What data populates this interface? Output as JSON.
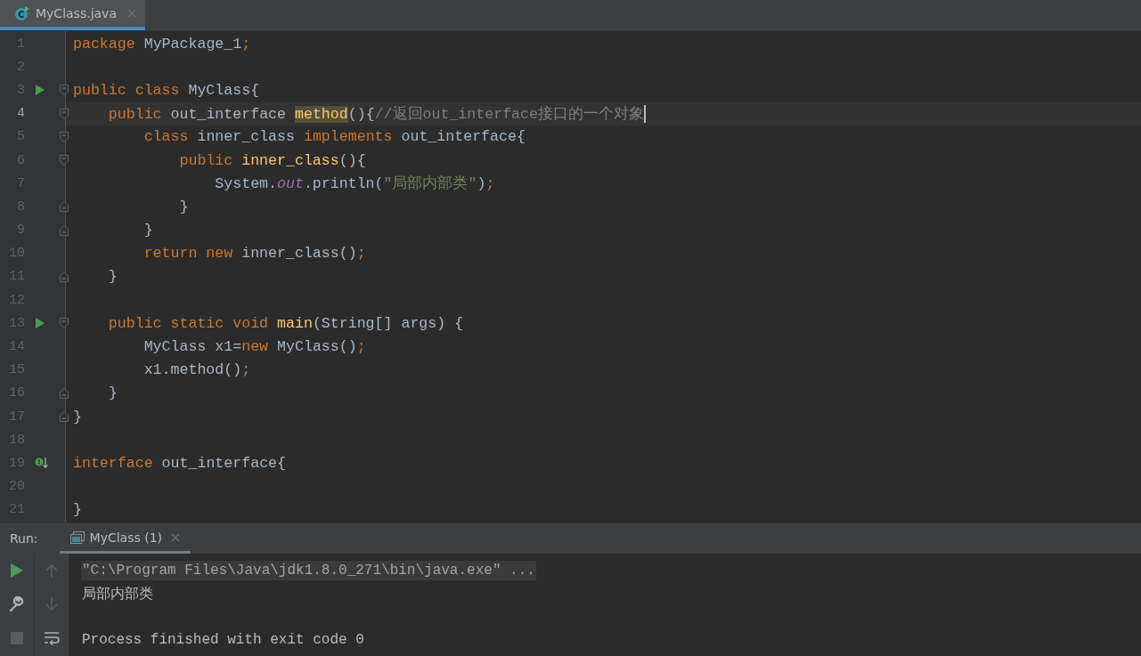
{
  "editor_tabs": [
    {
      "label": "MyClass.java",
      "selected": true
    }
  ],
  "code_lines": [
    {
      "number": "1",
      "kind": "plain",
      "fold_start": false,
      "fold_end": false,
      "current": false,
      "tokens": [
        {
          "kind": "keyword",
          "text": "package "
        },
        {
          "kind": "ident",
          "text": "MyPackage_1"
        },
        {
          "kind": "keyword",
          "text": ";"
        }
      ]
    },
    {
      "number": "2",
      "kind": "plain",
      "fold_start": false,
      "fold_end": false,
      "current": false
    },
    {
      "number": "3",
      "kind": "run",
      "fold_start": true,
      "fold_end": false,
      "current": false,
      "tokens": [
        {
          "kind": "keyword",
          "text": "public class "
        },
        {
          "kind": "ident",
          "text": "MyClass{"
        }
      ]
    },
    {
      "number": "4",
      "kind": "plain",
      "fold_start": true,
      "fold_end": false,
      "current": true,
      "tokens": [
        {
          "kind": "keyword",
          "text": "    public "
        },
        {
          "kind": "ident",
          "text": "out_interface "
        },
        {
          "kind": "method_usage",
          "text": "method"
        },
        {
          "kind": "ident",
          "text": "(){"
        },
        {
          "kind": "comment",
          "text": "//返回out_interface接口的一个对象"
        }
      ]
    },
    {
      "number": "5",
      "kind": "plain",
      "fold_start": true,
      "fold_end": false,
      "current": false,
      "tokens": [
        {
          "kind": "keyword",
          "text": "        class "
        },
        {
          "kind": "ident",
          "text": "inner_class "
        },
        {
          "kind": "keyword",
          "text": "implements "
        },
        {
          "kind": "ident",
          "text": "out_interface{"
        }
      ]
    },
    {
      "number": "6",
      "kind": "plain",
      "fold_start": true,
      "fold_end": false,
      "current": false,
      "tokens": [
        {
          "kind": "keyword",
          "text": "            public "
        },
        {
          "kind": "method",
          "text": "inner_class"
        },
        {
          "kind": "ident",
          "text": "(){"
        }
      ]
    },
    {
      "number": "7",
      "kind": "plain",
      "fold_start": false,
      "fold_end": false,
      "current": false,
      "tokens": [
        {
          "kind": "ident",
          "text": "                System."
        },
        {
          "kind": "field",
          "text": "out"
        },
        {
          "kind": "ident",
          "text": ".println("
        },
        {
          "kind": "string",
          "text": "\"局部内部类\""
        },
        {
          "kind": "ident",
          "text": ")"
        },
        {
          "kind": "keyword",
          "text": ";"
        }
      ]
    },
    {
      "number": "8",
      "kind": "plain",
      "fold_start": false,
      "fold_end": true,
      "current": false,
      "tokens": [
        {
          "kind": "ident",
          "text": "            }"
        }
      ]
    },
    {
      "number": "9",
      "kind": "plain",
      "fold_start": false,
      "fold_end": true,
      "current": false,
      "tokens": [
        {
          "kind": "ident",
          "text": "        }"
        }
      ]
    },
    {
      "number": "10",
      "kind": "plain",
      "fold_start": false,
      "fold_end": false,
      "current": false,
      "tokens": [
        {
          "kind": "keyword",
          "text": "        return new "
        },
        {
          "kind": "ident",
          "text": "inner_class()"
        },
        {
          "kind": "keyword",
          "text": ";"
        }
      ]
    },
    {
      "number": "11",
      "kind": "plain",
      "fold_start": false,
      "fold_end": true,
      "current": false,
      "tokens": [
        {
          "kind": "ident",
          "text": "    }"
        }
      ]
    },
    {
      "number": "12",
      "kind": "plain",
      "fold_start": false,
      "fold_end": false,
      "current": false
    },
    {
      "number": "13",
      "kind": "run",
      "fold_start": true,
      "fold_end": false,
      "current": false,
      "tokens": [
        {
          "kind": "keyword",
          "text": "    public static void "
        },
        {
          "kind": "method",
          "text": "main"
        },
        {
          "kind": "ident",
          "text": "(String[] args) {"
        }
      ]
    },
    {
      "number": "14",
      "kind": "plain",
      "fold_start": false,
      "fold_end": false,
      "current": false,
      "tokens": [
        {
          "kind": "ident",
          "text": "        MyClass x1="
        },
        {
          "kind": "keyword",
          "text": "new "
        },
        {
          "kind": "ident",
          "text": "MyClass()"
        },
        {
          "kind": "keyword",
          "text": ";"
        }
      ]
    },
    {
      "number": "15",
      "kind": "plain",
      "fold_start": false,
      "fold_end": false,
      "current": false,
      "tokens": [
        {
          "kind": "ident",
          "text": "        x1.method()"
        },
        {
          "kind": "keyword",
          "text": ";"
        }
      ]
    },
    {
      "number": "16",
      "kind": "plain",
      "fold_start": false,
      "fold_end": true,
      "current": false,
      "tokens": [
        {
          "kind": "ident",
          "text": "    }"
        }
      ]
    },
    {
      "number": "17",
      "kind": "plain",
      "fold_start": false,
      "fold_end": true,
      "current": false,
      "tokens": [
        {
          "kind": "ident",
          "text": "}"
        }
      ]
    },
    {
      "number": "18",
      "kind": "plain",
      "fold_start": false,
      "fold_end": false,
      "current": false
    },
    {
      "number": "19",
      "kind": "implemented",
      "fold_start": false,
      "fold_end": false,
      "current": false,
      "tokens": [
        {
          "kind": "keyword",
          "text": "interface "
        },
        {
          "kind": "ident",
          "text": "out_interface{"
        }
      ]
    },
    {
      "number": "20",
      "kind": "plain",
      "fold_start": false,
      "fold_end": false,
      "current": false
    },
    {
      "number": "21",
      "kind": "plain",
      "fold_start": false,
      "fold_end": false,
      "current": false,
      "tokens": [
        {
          "kind": "ident",
          "text": "}"
        }
      ]
    }
  ],
  "run_panel": {
    "label": "Run:",
    "tabs": [
      {
        "label": "MyClass (1)",
        "selected": true
      }
    ],
    "console": [
      {
        "kind": "command",
        "text": "\"C:\\Program Files\\Java\\jdk1.8.0_271\\bin\\java.exe\" ..."
      },
      {
        "kind": "output",
        "text": "局部内部类"
      },
      {
        "kind": "blank"
      },
      {
        "kind": "output",
        "text": "Process finished with exit code 0"
      }
    ]
  }
}
